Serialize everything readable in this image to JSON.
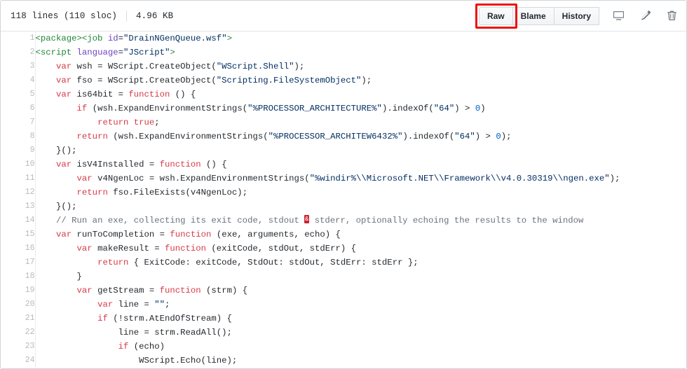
{
  "header": {
    "lines_label": "118 lines (110 sloc)",
    "size_label": "4.96 KB",
    "buttons": [
      {
        "label": "Raw",
        "name": "raw-button",
        "highlighted": true
      },
      {
        "label": "Blame",
        "name": "blame-button",
        "highlighted": false
      },
      {
        "label": "History",
        "name": "history-button",
        "highlighted": false
      }
    ],
    "icons": [
      {
        "name": "desktop-icon",
        "title": "Open this file in GitHub Desktop"
      },
      {
        "name": "pencil-icon",
        "title": "Edit this file"
      },
      {
        "name": "trash-icon",
        "title": "Delete this file"
      }
    ],
    "annotation_color": "#ee1111"
  },
  "code": {
    "language": "JScript / WSF",
    "lines": [
      {
        "n": "1",
        "tokens": [
          {
            "t": "tag",
            "v": "<package>"
          },
          {
            "t": "tag",
            "v": "<job "
          },
          {
            "t": "attr",
            "v": "id"
          },
          {
            "t": "plain",
            "v": "="
          },
          {
            "t": "str",
            "v": "\"DrainNGenQueue.wsf\""
          },
          {
            "t": "tag",
            "v": ">"
          }
        ]
      },
      {
        "n": "2",
        "tokens": [
          {
            "t": "tag",
            "v": "<script "
          },
          {
            "t": "attr",
            "v": "language"
          },
          {
            "t": "plain",
            "v": "="
          },
          {
            "t": "str",
            "v": "\"JScript\""
          },
          {
            "t": "tag",
            "v": ">"
          }
        ]
      },
      {
        "n": "3",
        "tokens": [
          {
            "t": "plain",
            "v": "    "
          },
          {
            "t": "kw",
            "v": "var"
          },
          {
            "t": "plain",
            "v": " wsh = WScript.CreateObject("
          },
          {
            "t": "str",
            "v": "\"WScript.Shell\""
          },
          {
            "t": "plain",
            "v": ");"
          }
        ]
      },
      {
        "n": "4",
        "tokens": [
          {
            "t": "plain",
            "v": "    "
          },
          {
            "t": "kw",
            "v": "var"
          },
          {
            "t": "plain",
            "v": " fso = WScript.CreateObject("
          },
          {
            "t": "str",
            "v": "\"Scripting.FileSystemObject\""
          },
          {
            "t": "plain",
            "v": ");"
          }
        ]
      },
      {
        "n": "5",
        "tokens": [
          {
            "t": "plain",
            "v": "    "
          },
          {
            "t": "kw",
            "v": "var"
          },
          {
            "t": "plain",
            "v": " is64bit = "
          },
          {
            "t": "kw",
            "v": "function"
          },
          {
            "t": "plain",
            "v": " () {"
          }
        ]
      },
      {
        "n": "6",
        "tokens": [
          {
            "t": "plain",
            "v": "        "
          },
          {
            "t": "kw",
            "v": "if"
          },
          {
            "t": "plain",
            "v": " (wsh.ExpandEnvironmentStrings("
          },
          {
            "t": "str",
            "v": "\"%PROCESSOR_ARCHITECTURE%\""
          },
          {
            "t": "plain",
            "v": ").indexOf("
          },
          {
            "t": "str",
            "v": "\"64\""
          },
          {
            "t": "plain",
            "v": ") > "
          },
          {
            "t": "num",
            "v": "0"
          },
          {
            "t": "plain",
            "v": ")"
          }
        ]
      },
      {
        "n": "7",
        "tokens": [
          {
            "t": "plain",
            "v": "            "
          },
          {
            "t": "kw",
            "v": "return"
          },
          {
            "t": "plain",
            "v": " "
          },
          {
            "t": "kw",
            "v": "true"
          },
          {
            "t": "plain",
            "v": ";"
          }
        ]
      },
      {
        "n": "8",
        "tokens": [
          {
            "t": "plain",
            "v": "        "
          },
          {
            "t": "kw",
            "v": "return"
          },
          {
            "t": "plain",
            "v": " (wsh.ExpandEnvironmentStrings("
          },
          {
            "t": "str",
            "v": "\"%PROCESSOR_ARCHITEW6432%\""
          },
          {
            "t": "plain",
            "v": ").indexOf("
          },
          {
            "t": "str",
            "v": "\"64\""
          },
          {
            "t": "plain",
            "v": ") > "
          },
          {
            "t": "num",
            "v": "0"
          },
          {
            "t": "plain",
            "v": ");"
          }
        ]
      },
      {
        "n": "9",
        "tokens": [
          {
            "t": "plain",
            "v": "    }();"
          }
        ]
      },
      {
        "n": "10",
        "tokens": [
          {
            "t": "plain",
            "v": "    "
          },
          {
            "t": "kw",
            "v": "var"
          },
          {
            "t": "plain",
            "v": " isV4Installed = "
          },
          {
            "t": "kw",
            "v": "function"
          },
          {
            "t": "plain",
            "v": " () {"
          }
        ]
      },
      {
        "n": "11",
        "tokens": [
          {
            "t": "plain",
            "v": "        "
          },
          {
            "t": "kw",
            "v": "var"
          },
          {
            "t": "plain",
            "v": " v4NgenLoc = wsh.ExpandEnvironmentStrings("
          },
          {
            "t": "str",
            "v": "\"%windir%\\\\Microsoft.NET\\\\Framework\\\\v4.0.30319\\\\ngen.exe\""
          },
          {
            "t": "plain",
            "v": ");"
          }
        ]
      },
      {
        "n": "12",
        "tokens": [
          {
            "t": "plain",
            "v": "        "
          },
          {
            "t": "kw",
            "v": "return"
          },
          {
            "t": "plain",
            "v": " fso.FileExists(v4NgenLoc);"
          }
        ]
      },
      {
        "n": "13",
        "tokens": [
          {
            "t": "plain",
            "v": "    }();"
          }
        ]
      },
      {
        "n": "14",
        "tokens": [
          {
            "t": "plain",
            "v": "    "
          },
          {
            "t": "com",
            "v": "// Run an exe, collecting its exit code, stdout "
          },
          {
            "t": "badchar",
            "v": "&"
          },
          {
            "t": "com",
            "v": " stderr, optionally echoing the results to the window"
          }
        ]
      },
      {
        "n": "15",
        "tokens": [
          {
            "t": "plain",
            "v": "    "
          },
          {
            "t": "kw",
            "v": "var"
          },
          {
            "t": "plain",
            "v": " runToCompletion = "
          },
          {
            "t": "kw",
            "v": "function"
          },
          {
            "t": "plain",
            "v": " (exe, arguments, echo) {"
          }
        ]
      },
      {
        "n": "16",
        "tokens": [
          {
            "t": "plain",
            "v": "        "
          },
          {
            "t": "kw",
            "v": "var"
          },
          {
            "t": "plain",
            "v": " makeResult = "
          },
          {
            "t": "kw",
            "v": "function"
          },
          {
            "t": "plain",
            "v": " (exitCode, stdOut, stdErr) {"
          }
        ]
      },
      {
        "n": "17",
        "tokens": [
          {
            "t": "plain",
            "v": "            "
          },
          {
            "t": "kw",
            "v": "return"
          },
          {
            "t": "plain",
            "v": " { ExitCode: exitCode, StdOut: stdOut, StdErr: stdErr };"
          }
        ]
      },
      {
        "n": "18",
        "tokens": [
          {
            "t": "plain",
            "v": "        }"
          }
        ]
      },
      {
        "n": "19",
        "tokens": [
          {
            "t": "plain",
            "v": "        "
          },
          {
            "t": "kw",
            "v": "var"
          },
          {
            "t": "plain",
            "v": " getStream = "
          },
          {
            "t": "kw",
            "v": "function"
          },
          {
            "t": "plain",
            "v": " (strm) {"
          }
        ]
      },
      {
        "n": "20",
        "tokens": [
          {
            "t": "plain",
            "v": "            "
          },
          {
            "t": "kw",
            "v": "var"
          },
          {
            "t": "plain",
            "v": " line = "
          },
          {
            "t": "str",
            "v": "\"\""
          },
          {
            "t": "plain",
            "v": ";"
          }
        ]
      },
      {
        "n": "21",
        "tokens": [
          {
            "t": "plain",
            "v": "            "
          },
          {
            "t": "kw",
            "v": "if"
          },
          {
            "t": "plain",
            "v": " (!strm.AtEndOfStream) {"
          }
        ]
      },
      {
        "n": "22",
        "tokens": [
          {
            "t": "plain",
            "v": "                line = strm.ReadAll();"
          }
        ]
      },
      {
        "n": "23",
        "tokens": [
          {
            "t": "plain",
            "v": "                "
          },
          {
            "t": "kw",
            "v": "if"
          },
          {
            "t": "plain",
            "v": " (echo)"
          }
        ]
      },
      {
        "n": "24",
        "tokens": [
          {
            "t": "plain",
            "v": "                    WScript.Echo(line);"
          }
        ]
      }
    ]
  }
}
